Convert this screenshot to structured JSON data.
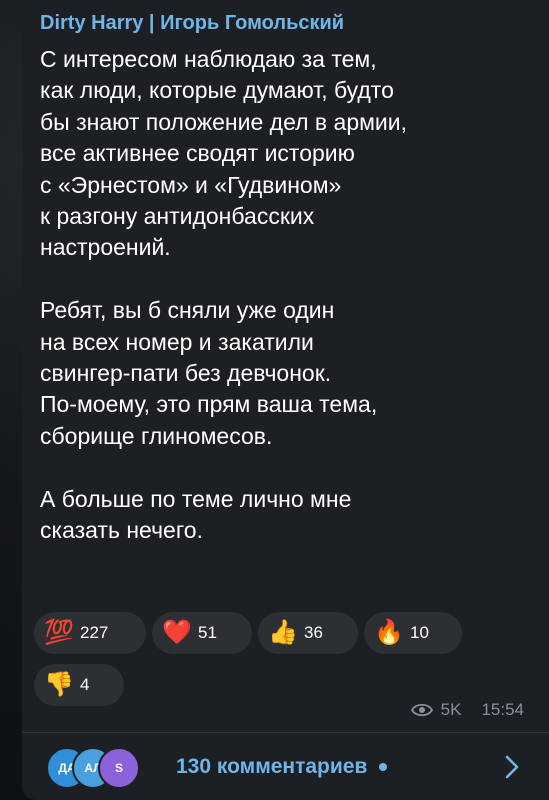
{
  "post": {
    "author": "Dirty Harry | Игорь Гомольский",
    "paragraphs": [
      "С интересом наблюдаю за тем,\nкак люди, которые думают, будто\nбы знают положение дел в армии,\nвсе активнее сводят историю\nс «Эрнестом» и «Гудвином»\nк разгону антидонбасских\nнастроений.",
      "Ребят, вы б сняли уже один\nна всех номер и закатили\nсвингер-пати без девчонок.\nПо-моему, это прям ваша тема,\nсборище глиномесов.",
      "А больше по теме лично мне\nсказать нечего."
    ],
    "views": "5K",
    "time": "15:54"
  },
  "reactions": [
    {
      "icon": "hundred-points-emoji",
      "emoji": "💯",
      "count": "227"
    },
    {
      "icon": "red-heart-emoji",
      "emoji": "❤️",
      "count": "51"
    },
    {
      "icon": "thumbs-up-emoji",
      "emoji": "👍",
      "count": "36"
    },
    {
      "icon": "fire-emoji",
      "emoji": "🔥",
      "count": "10"
    },
    {
      "icon": "thumbs-down-emoji",
      "emoji": "👎",
      "count": "4"
    }
  ],
  "comments": {
    "label": "130 комментариев",
    "avatars": [
      {
        "text": "ДА",
        "color": "#2f8fd8"
      },
      {
        "text": "АЛ",
        "color": "#4aa0df"
      },
      {
        "text": "S",
        "color": "#8b62d9"
      }
    ]
  },
  "colors": {
    "accent": "#6fb5e8",
    "bubble": "#1c1f23",
    "reaction_bg": "#2c3035"
  }
}
